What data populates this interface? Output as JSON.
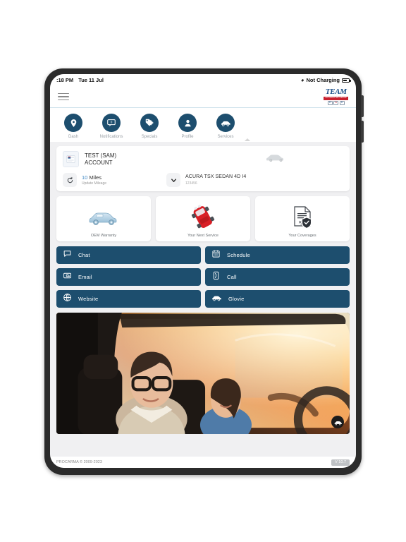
{
  "device": {
    "status_bar": {
      "time": ":18 PM",
      "date": "Tue 11 Jul",
      "wifi_icon": "wifi-icon",
      "charging_status": "Not Charging",
      "battery_icon": "battery-icon"
    }
  },
  "header": {
    "menu_icon": "hamburger-menu-icon",
    "logo": {
      "word": "TEAM",
      "tagline": "AUTOMOTIVE GROUP",
      "chips": [
        "H",
        "A",
        "K"
      ]
    }
  },
  "nav": {
    "items": [
      {
        "label": "Dash",
        "icon": "location-pin-icon"
      },
      {
        "label": "Notifications",
        "icon": "chat-bubble-icon",
        "badge": "0"
      },
      {
        "label": "Specials",
        "icon": "tags-icon"
      },
      {
        "label": "Profile",
        "icon": "person-icon"
      },
      {
        "label": "Services",
        "icon": "car-icon"
      }
    ]
  },
  "account_card": {
    "avatar_icon": "id-card-icon",
    "name_line_1": "TEST (SAM)",
    "name_line_2": "ACCOUNT",
    "vehicle_thumb_icon": "car-silhouette-icon",
    "mileage": {
      "refresh_icon": "refresh-icon",
      "value": "10",
      "unit": "Miles",
      "sub_label": "Update Mileage"
    },
    "vehicle": {
      "chevron_icon": "chevron-down-icon",
      "name": "ACURA TSX SEDAN 4D I4",
      "id": "123456"
    }
  },
  "tiles": [
    {
      "label": "OEM Warranty",
      "icon": "blue-car-chassis-icon"
    },
    {
      "label": "Your Next Service",
      "icon": "red-car-icon"
    },
    {
      "label": "Your Coverages",
      "icon": "document-shield-icon"
    }
  ],
  "actions": [
    {
      "label": "Chat",
      "icon": "chat-bubble-icon"
    },
    {
      "label": "Schedule",
      "icon": "calendar-icon"
    },
    {
      "label": "Email",
      "icon": "email-icon"
    },
    {
      "label": "Call",
      "icon": "phone-icon"
    },
    {
      "label": "Website",
      "icon": "globe-icon"
    },
    {
      "label": "Glovie",
      "icon": "glovebox-car-icon"
    }
  ],
  "hero": {
    "alt": "couple-driving-in-car",
    "badge_icon": "car-badge-icon"
  },
  "footer": {
    "copyright": "PROCARMA © 2009-2023",
    "version": "V 10.7"
  },
  "colors": {
    "brand_navy": "#1d4e6e",
    "logo_blue": "#1a4f88",
    "logo_red": "#c8202e",
    "accent_blue": "#3f88c5"
  }
}
